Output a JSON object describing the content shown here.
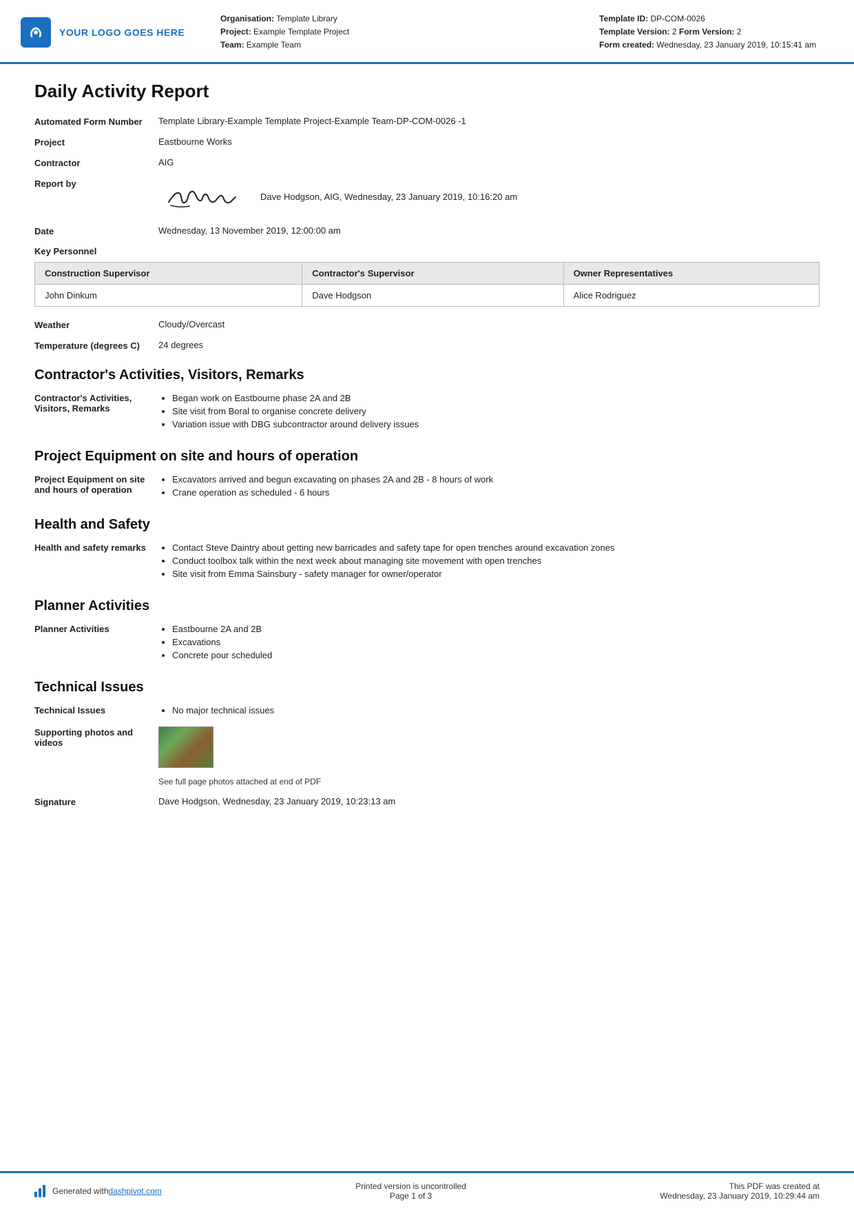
{
  "header": {
    "logo_text": "YOUR LOGO GOES HERE",
    "org_label": "Organisation:",
    "org_value": "Template Library",
    "project_label": "Project:",
    "project_value": "Example Template Project",
    "team_label": "Team:",
    "team_value": "Example Team",
    "template_id_label": "Template ID:",
    "template_id_value": "DP-COM-0026",
    "template_version_label": "Template Version:",
    "template_version_value": "2",
    "form_version_label": "Form Version:",
    "form_version_value": "2",
    "form_created_label": "Form created:",
    "form_created_value": "Wednesday, 23 January 2019, 10:15:41 am"
  },
  "report": {
    "title": "Daily Activity Report",
    "fields": {
      "automated_label": "Automated Form Number",
      "automated_value": "Template Library-Example Template Project-Example Team-DP-COM-0026   -1",
      "project_label": "Project",
      "project_value": "Eastbourne Works",
      "contractor_label": "Contractor",
      "contractor_value": "AIG",
      "report_by_label": "Report by",
      "report_by_person": "Dave Hodgson, AIG, Wednesday, 23 January 2019, 10:16:20 am",
      "date_label": "Date",
      "date_value": "Wednesday, 13 November 2019, 12:00:00 am"
    },
    "key_personnel": {
      "label": "Key Personnel",
      "columns": [
        "Construction Supervisor",
        "Contractor's Supervisor",
        "Owner Representatives"
      ],
      "row": [
        "John Dinkum",
        "Dave Hodgson",
        "Alice Rodriguez"
      ]
    },
    "weather_label": "Weather",
    "weather_value": "Cloudy/Overcast",
    "temperature_label": "Temperature (degrees C)",
    "temperature_value": "24 degrees"
  },
  "sections": {
    "contractors": {
      "title": "Contractor's Activities, Visitors, Remarks",
      "label": "Contractor's Activities, Visitors, Remarks",
      "items": [
        "Began work on Eastbourne phase 2A and 2B",
        "Site visit from Boral to organise concrete delivery",
        "Variation issue with DBG subcontractor around delivery issues"
      ]
    },
    "equipment": {
      "title": "Project Equipment on site and hours of operation",
      "label": "Project Equipment on site and hours of operation",
      "items": [
        "Excavators arrived and begun excavating on phases 2A and 2B - 8 hours of work",
        "Crane operation as scheduled - 6 hours"
      ]
    },
    "health_safety": {
      "title": "Health and Safety",
      "label": "Health and safety remarks",
      "items": [
        "Contact Steve Daintry about getting new barricades and safety tape for open trenches around excavation zones",
        "Conduct toolbox talk within the next week about managing site movement with open trenches",
        "Site visit from Emma Sainsbury - safety manager for owner/operator"
      ]
    },
    "planner": {
      "title": "Planner Activities",
      "label": "Planner Activities",
      "items": [
        "Eastbourne 2A and 2B",
        "Excavations",
        "Concrete pour scheduled"
      ]
    },
    "technical": {
      "title": "Technical Issues",
      "label": "Technical Issues",
      "items": [
        "No major technical issues"
      ],
      "supporting_label": "Supporting photos and videos",
      "photo_caption": "See full page photos attached at end of PDF",
      "signature_label": "Signature",
      "signature_value": "Dave Hodgson, Wednesday, 23 January 2019, 10:23:13 am"
    }
  },
  "footer": {
    "generated_text": "Generated with ",
    "site_link": "dashpivot.com",
    "center_text": "Printed version is uncontrolled",
    "page_text": "Page 1 of 3",
    "right_text": "This PDF was created at",
    "right_date": "Wednesday, 23 January 2019, 10:29:44 am"
  }
}
